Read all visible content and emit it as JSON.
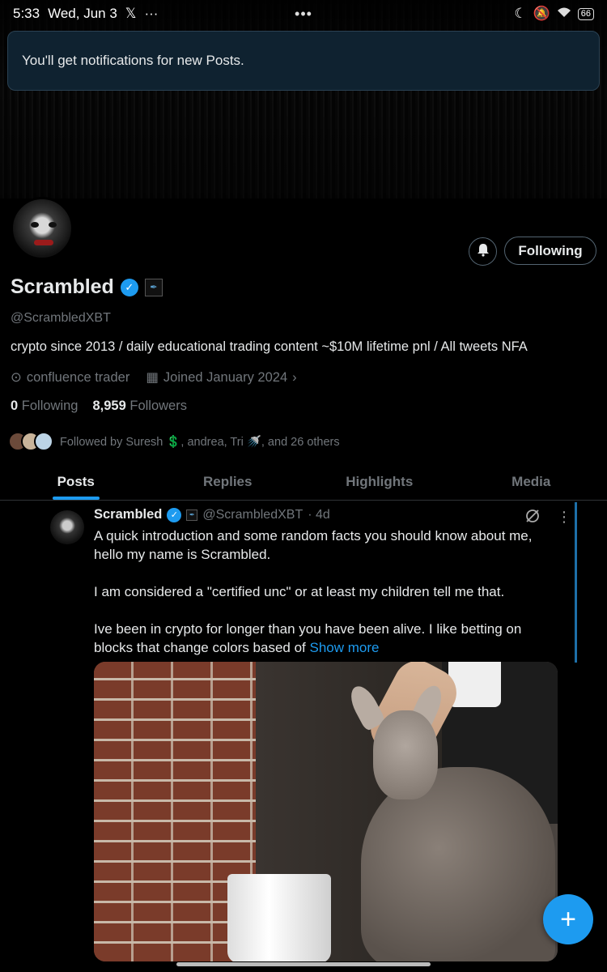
{
  "status_bar": {
    "time": "5:33",
    "date": "Wed, Jun 3",
    "app_glyph": "𝕏",
    "more": "···",
    "center_dots": "•••",
    "battery": "66"
  },
  "toast": {
    "text": "You'll get notifications for new Posts."
  },
  "profile": {
    "name": "Scrambled",
    "handle": "@ScrambledXBT",
    "bio": "crypto since 2013 / daily educational trading content   ~$10M lifetime pnl / All tweets NFA",
    "location": "confluence trader",
    "joined": "Joined January 2024",
    "following_count": "0",
    "following_label": "Following",
    "followers_count": "8,959",
    "followers_label": "Followers",
    "followed_by": "Followed by Suresh 💲, andrea, Tri 🚿, and 26 others",
    "follow_button": "Following"
  },
  "tabs": [
    {
      "label": "Posts",
      "active": true
    },
    {
      "label": "Replies",
      "active": false
    },
    {
      "label": "Highlights",
      "active": false
    },
    {
      "label": "Media",
      "active": false
    }
  ],
  "post": {
    "author": "Scrambled",
    "handle": "@ScrambledXBT",
    "time": "· 4d",
    "paragraphs": [
      "A quick introduction and some random facts you should know about me, hello my name is Scrambled.",
      "I am considered a \"certified unc\" or at least my children tell me that.",
      "Ive been in crypto for longer than you have been alive. I like betting on blocks that change colors based of "
    ],
    "show_more": "Show more"
  },
  "fab": {
    "label": "+"
  },
  "colors": {
    "accent": "#1d9bf0",
    "background": "#000000",
    "muted": "#71767b"
  }
}
